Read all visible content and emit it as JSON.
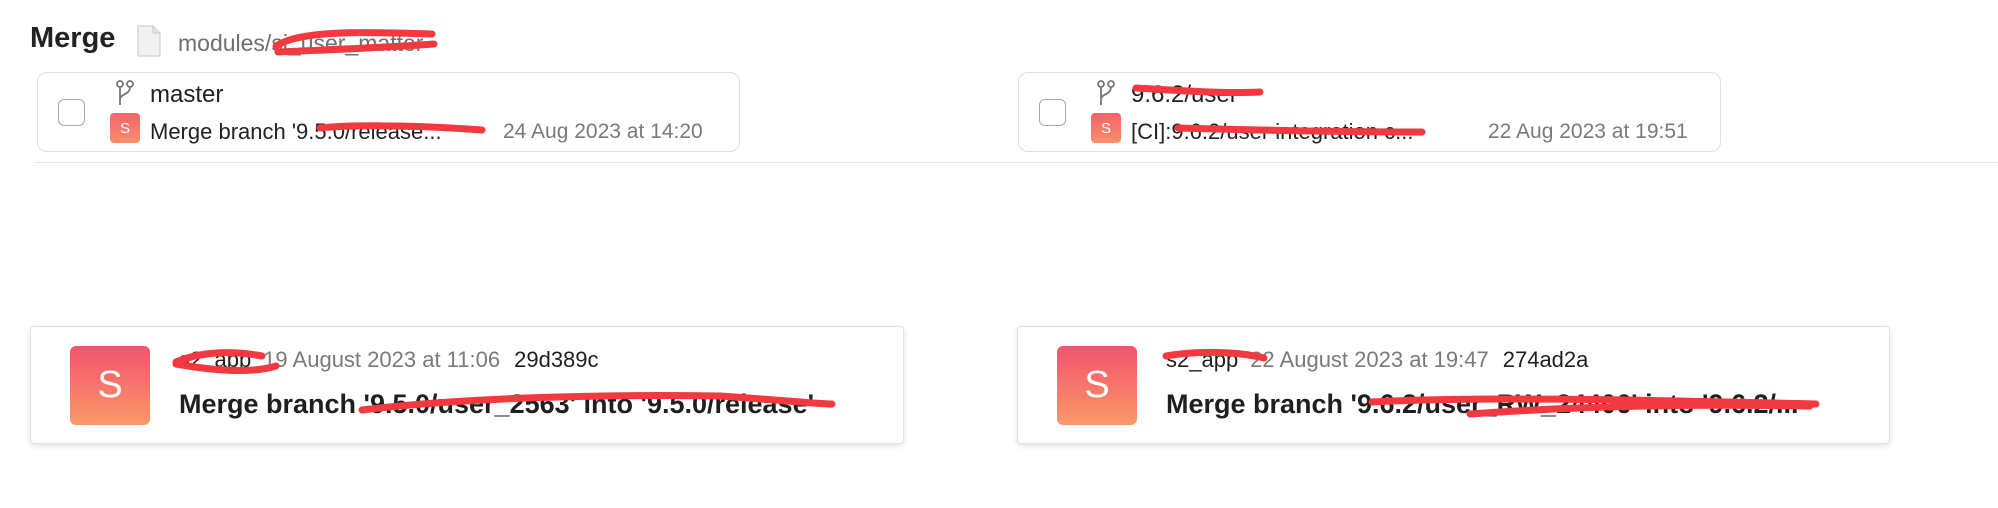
{
  "header": {
    "title": "Merge",
    "path": "modules/si_user_matter"
  },
  "branches": [
    {
      "name": "master",
      "avatar_letter": "S",
      "commit_message": "Merge branch '9.5.0/release...",
      "date": "24 Aug 2023 at 14:20"
    },
    {
      "name": "9.6.2/user",
      "avatar_letter": "S",
      "commit_message": "[CI]:9.6.2/user integration c...",
      "date": "22 Aug 2023 at 19:51"
    }
  ],
  "commits": [
    {
      "avatar_letter": "S",
      "author": "s2_app",
      "date": "19 August 2023 at 11:06",
      "hash": "29d389c",
      "subject": "Merge branch '9.5.0/user_2563' into '9.5.0/release'"
    },
    {
      "avatar_letter": "S",
      "author": "s2_app",
      "date": "22 August 2023 at 19:47",
      "hash": "274ad2a",
      "subject": "Merge branch '9.6.2/user_RW_24406' into '9.6.2/..."
    }
  ],
  "colors": {
    "avatar_top": "#f4536f",
    "avatar_bottom": "#fa9a66",
    "redaction": "#f2393f"
  }
}
